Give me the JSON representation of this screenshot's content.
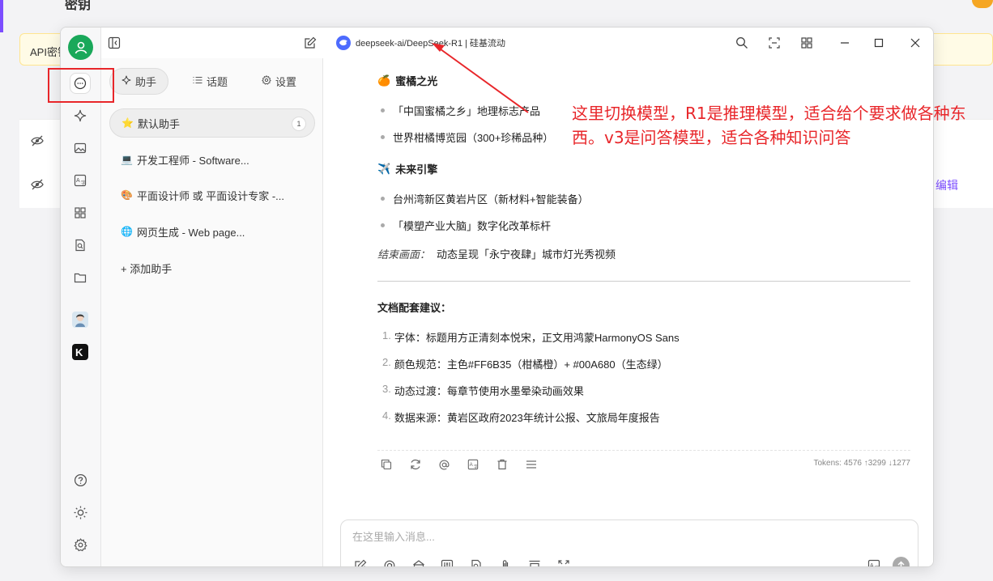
{
  "background": {
    "title": "密钥",
    "warning": "API密钥",
    "edit_label": "编辑"
  },
  "window": {
    "model": {
      "name": "deepseek-ai/DeepSeek-R1 | 硅基流动"
    }
  },
  "sidebar": {
    "tabs": [
      {
        "label": "助手"
      },
      {
        "label": "话题"
      },
      {
        "label": "设置"
      }
    ],
    "assistants": [
      {
        "emoji": "⭐",
        "name": "默认助手",
        "count": "1"
      },
      {
        "emoji": "💻",
        "name": "开发工程师 - Software..."
      },
      {
        "emoji": "🎨",
        "name": "平面设计师 或 平面设计专家 -..."
      },
      {
        "emoji": "🌐",
        "name": "网页生成 - Web page..."
      }
    ],
    "add_label": "+ 添加助手"
  },
  "message": {
    "section1": {
      "emoji": "🍊",
      "title": "蜜橘之光"
    },
    "section1_items": [
      "「中国蜜橘之乡」地理标志产品",
      "世界柑橘博览园（300+珍稀品种）"
    ],
    "section2": {
      "emoji": "✈️",
      "title": "未来引擎"
    },
    "section2_items": [
      "台州湾新区黄岩片区（新材料+智能装备）",
      "「模塑产业大脑」数字化改革标杆"
    ],
    "ending_label": "结束画面：",
    "ending_text": "动态呈现「永宁夜肆」城市灯光秀视频",
    "doc_title": "文档配套建议：",
    "doc_items": [
      "字体：标题用方正清刻本悦宋，正文用鸿蒙HarmonyOS Sans",
      "颜色规范：主色#FF6B35（柑橘橙）+ #00A680（生态绿）",
      "动态过渡：每章节使用水墨晕染动画效果",
      "数据来源：黄岩区政府2023年统计公报、文旅局年度报告"
    ],
    "tokens": "Tokens: 4576 ↑3299 ↓1277"
  },
  "input": {
    "placeholder": "在这里输入消息..."
  },
  "annotation": {
    "text": "这里切换模型，R1是推理模型，适合给个要求做各种东西。v3是问答模型，适合各种知识问答",
    "color": "#e8262a"
  }
}
